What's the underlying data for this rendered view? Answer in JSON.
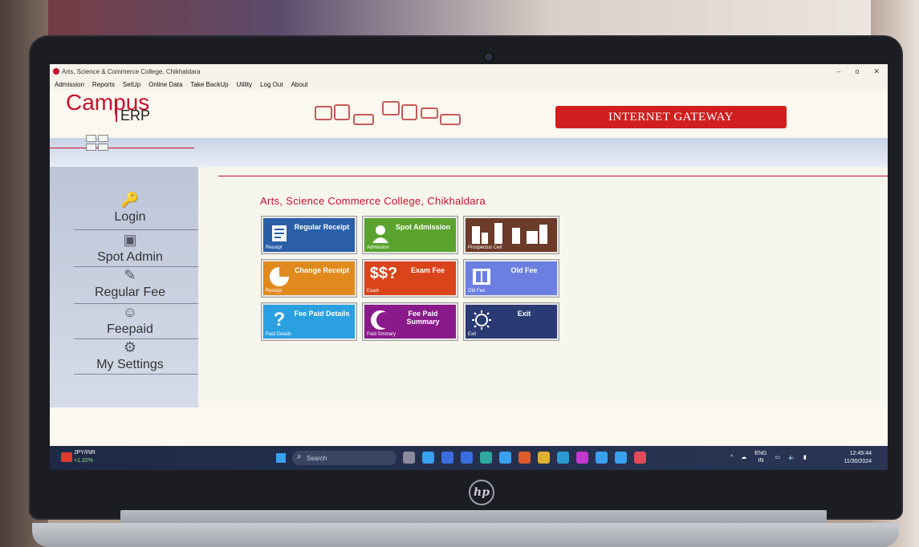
{
  "window": {
    "title": "Arts, Science & Commerce College, Chikhaldara",
    "minimize": "–",
    "maximize": "o",
    "close": "✕"
  },
  "menu": [
    "Admission",
    "Reports",
    "SetUp",
    "Online Data",
    "Take BackUp",
    "Utility",
    "Log Out",
    "About"
  ],
  "header": {
    "logo_campus": "Campus",
    "logo_erp": "ERP",
    "gateway_label": "INTERNET GATEWAY"
  },
  "sidebar": {
    "items": [
      {
        "label": "Login",
        "icon": "key-icon"
      },
      {
        "label": "Spot Admin",
        "icon": "person-card-icon"
      },
      {
        "label": "Regular Fee",
        "icon": "document-icon"
      },
      {
        "label": "Feepaid",
        "icon": "people-icon"
      },
      {
        "label": "My Settings",
        "icon": "settings-users-icon"
      }
    ]
  },
  "main": {
    "college_title": "Arts, Science  Commerce College, Chikhaldara",
    "tiles": [
      {
        "title": "Regular Receipt",
        "sub": "Receipt",
        "color": "#2a5fa8",
        "icon": "document-icon"
      },
      {
        "title": "Spot Admission",
        "sub": "Admission",
        "color": "#5aa32e",
        "icon": "person-icon"
      },
      {
        "title": "",
        "sub": "Prospectus Cell",
        "color": "#6b3a28",
        "icon": "bar-chart-icon"
      },
      {
        "title": "Change Receipt",
        "sub": "Receipt",
        "color": "#e08a1e",
        "icon": "pie-icon"
      },
      {
        "title": "Exam Fee",
        "sub": "Exam",
        "color": "#d9441a",
        "icon": "dollar-icon",
        "icon_text": "$$?"
      },
      {
        "title": "Old Fee",
        "sub": "Old Fee",
        "color": "#6a7fe0",
        "icon": "book-icon"
      },
      {
        "title": "Fee Paid Details",
        "sub": "Paid Details",
        "color": "#2aa0e0",
        "icon": "question-icon",
        "icon_text": "?"
      },
      {
        "title": "Fee Paid Summary",
        "sub": "Paid Smmary",
        "color": "#8a1a8a",
        "icon": "moon-icon"
      },
      {
        "title": "Exit",
        "sub": "Exit",
        "color": "#2a3a72",
        "icon": "sun-icon"
      }
    ]
  },
  "taskbar": {
    "stock_symbol": "JPY/INR",
    "stock_change": "+1.32%",
    "search_placeholder": "Search",
    "lang_top": "ENG",
    "lang_bottom": "IN",
    "time": "12:45:44",
    "date": "11/30/2024",
    "app_colors": [
      "#8a8a9a",
      "#3aa0f0",
      "#3a6ee0",
      "#3a6ee0",
      "#2ea8a0",
      "#3aa0f0",
      "#e05a2a",
      "#e0b030",
      "#2a9ad0",
      "#c03ad0",
      "#3aa0f0",
      "#3aa0f0",
      "#e04a5a"
    ]
  },
  "device": {
    "brand": "hp"
  }
}
